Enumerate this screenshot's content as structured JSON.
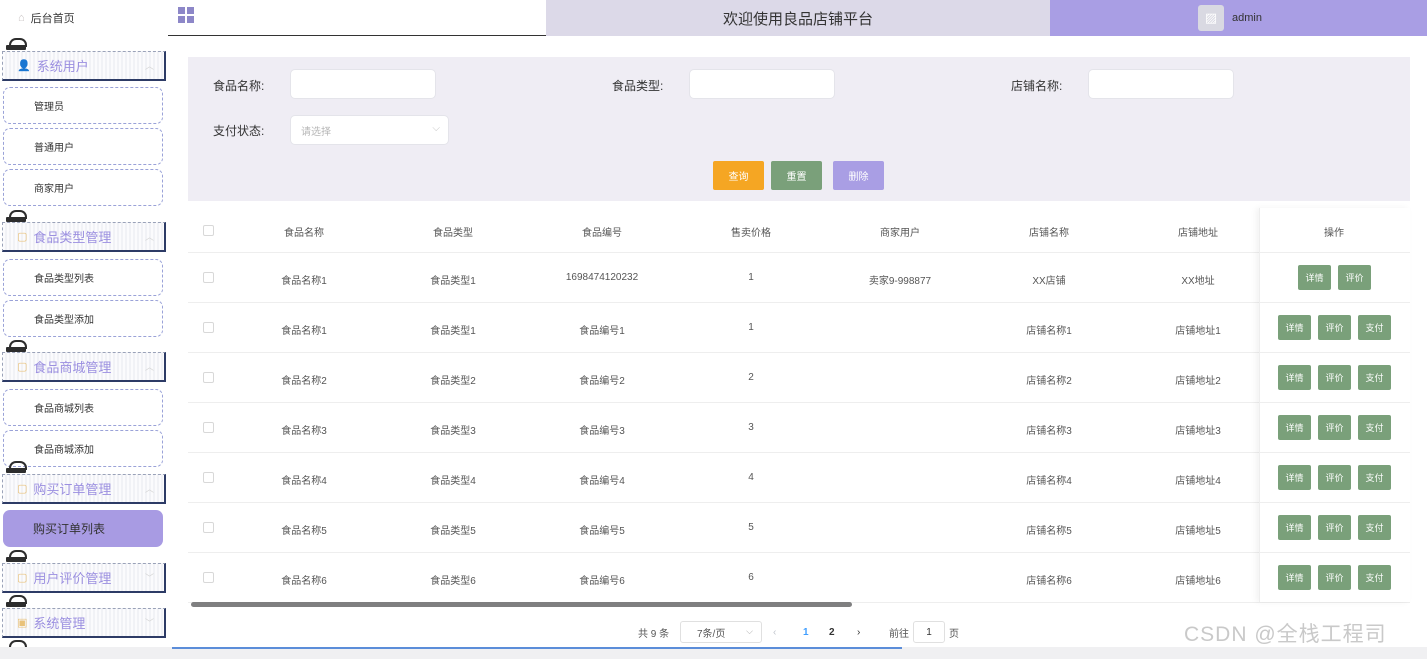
{
  "sidebar": {
    "home": "后台首页",
    "groups": [
      {
        "title": "系统用户",
        "items": [
          "管理员",
          "普通用户",
          "商家用户"
        ]
      },
      {
        "title": "食品类型管理",
        "items": [
          "食品类型列表",
          "食品类型添加"
        ]
      },
      {
        "title": "食品商城管理",
        "items": [
          "食品商城列表",
          "食品商城添加"
        ]
      },
      {
        "title": "购买订单管理",
        "items": [
          "购买订单列表"
        ]
      },
      {
        "title": "用户评价管理",
        "items": []
      },
      {
        "title": "系统管理",
        "items": []
      }
    ],
    "active_item": "购买订单列表"
  },
  "header": {
    "title": "欢迎使用良品店铺平台",
    "username": "admin"
  },
  "search": {
    "food_name_label": "食品名称:",
    "food_type_label": "食品类型:",
    "shop_name_label": "店铺名称:",
    "pay_status_label": "支付状态:",
    "pay_status_placeholder": "请选择",
    "query_button": "查询",
    "reset_button": "重置",
    "delete_button": "删除"
  },
  "table": {
    "columns": [
      "食品名称",
      "食品类型",
      "食品编号",
      "售卖价格",
      "商家用户",
      "店铺名称",
      "店铺地址",
      "操作"
    ],
    "rows": [
      {
        "name": "食品名称1",
        "type": "食品类型1",
        "code": "1698474120232",
        "price": "1",
        "merchant": "卖家9-998877",
        "shop": "XX店铺",
        "address": "XX地址",
        "ops": [
          "详情",
          "评价"
        ]
      },
      {
        "name": "食品名称1",
        "type": "食品类型1",
        "code": "食品编号1",
        "price": "1",
        "merchant": "",
        "shop": "店铺名称1",
        "address": "店铺地址1",
        "ops": [
          "详情",
          "评价",
          "支付"
        ]
      },
      {
        "name": "食品名称2",
        "type": "食品类型2",
        "code": "食品编号2",
        "price": "2",
        "merchant": "",
        "shop": "店铺名称2",
        "address": "店铺地址2",
        "ops": [
          "详情",
          "评价",
          "支付"
        ]
      },
      {
        "name": "食品名称3",
        "type": "食品类型3",
        "code": "食品编号3",
        "price": "3",
        "merchant": "",
        "shop": "店铺名称3",
        "address": "店铺地址3",
        "ops": [
          "详情",
          "评价",
          "支付"
        ]
      },
      {
        "name": "食品名称4",
        "type": "食品类型4",
        "code": "食品编号4",
        "price": "4",
        "merchant": "",
        "shop": "店铺名称4",
        "address": "店铺地址4",
        "ops": [
          "详情",
          "评价",
          "支付"
        ]
      },
      {
        "name": "食品名称5",
        "type": "食品类型5",
        "code": "食品编号5",
        "price": "5",
        "merchant": "",
        "shop": "店铺名称5",
        "address": "店铺地址5",
        "ops": [
          "详情",
          "评价",
          "支付"
        ]
      },
      {
        "name": "食品名称6",
        "type": "食品类型6",
        "code": "食品编号6",
        "price": "6",
        "merchant": "",
        "shop": "店铺名称6",
        "address": "店铺地址6",
        "ops": [
          "详情",
          "评价",
          "支付"
        ]
      }
    ]
  },
  "pagination": {
    "total": "共 9 条",
    "page_size": "7条/页",
    "prev": "‹",
    "pages": [
      "1",
      "2"
    ],
    "current_page": "1",
    "next": "›",
    "goto_label": "前往",
    "goto_value": "1",
    "page_unit": "页"
  },
  "watermark": "CSDN @全栈工程司",
  "colors": {
    "accent": "#a99ee4",
    "query": "#f5a623",
    "reset": "#7aa07a",
    "delete": "#a99ee4",
    "op_button": "#7aa07a",
    "link": "#409eff"
  }
}
